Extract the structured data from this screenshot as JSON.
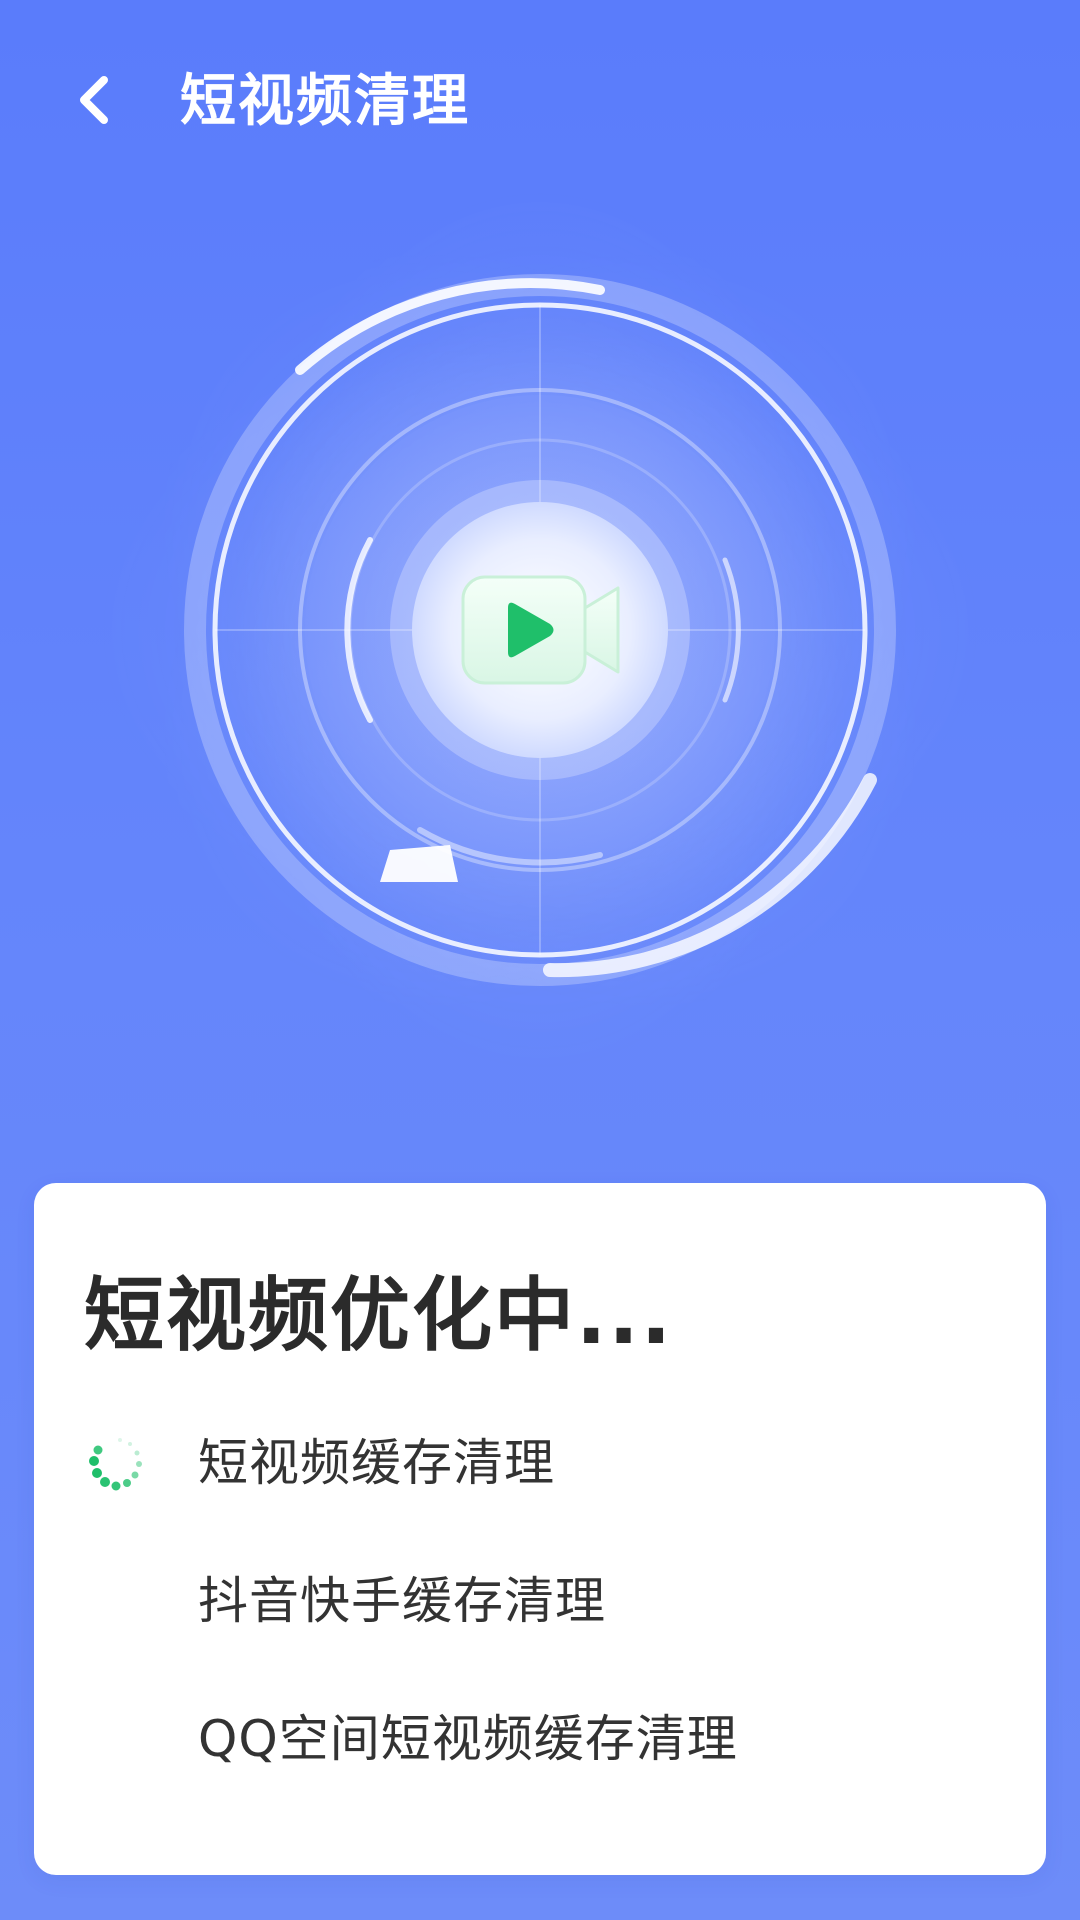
{
  "header": {
    "back_icon": "chevron-left-icon",
    "title": "短视频清理"
  },
  "illustration": {
    "center_icon": "video-camera-play-icon",
    "accent_color": "#1fbf6a",
    "background_color": "#5a7cfb"
  },
  "status_card": {
    "title": "短视频优化中...",
    "tasks": [
      {
        "label": "短视频缓存清理",
        "state": "in-progress",
        "icon": "loading-spinner-icon"
      },
      {
        "label": "抖音快手缓存清理",
        "state": "pending"
      },
      {
        "label": "QQ空间短视频缓存清理",
        "state": "pending"
      }
    ]
  }
}
